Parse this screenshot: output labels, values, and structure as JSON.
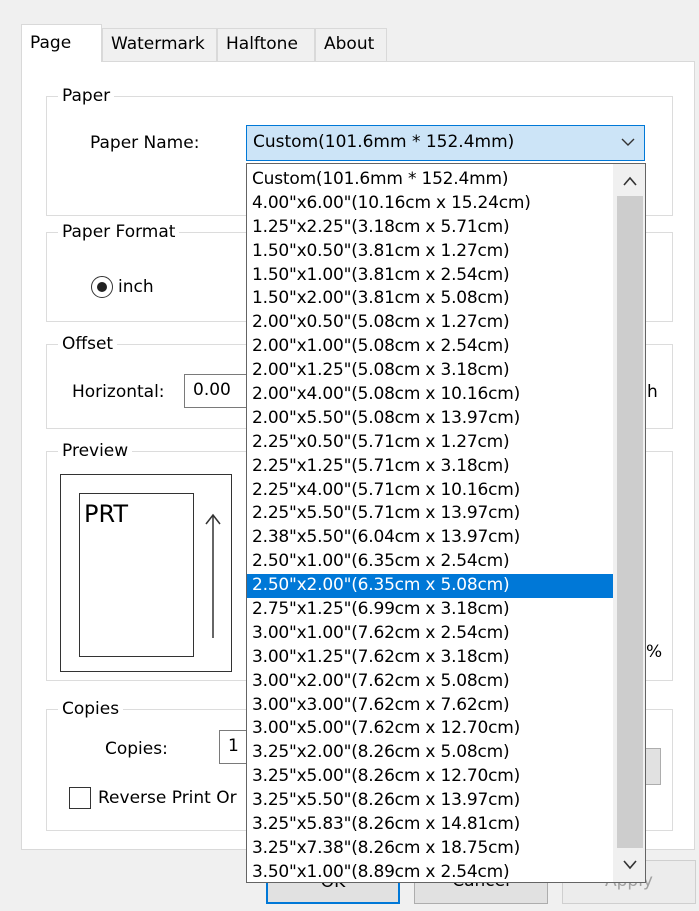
{
  "tabs": [
    {
      "label": "Page",
      "active": true
    },
    {
      "label": "Watermark",
      "active": false
    },
    {
      "label": "Halftone",
      "active": false
    },
    {
      "label": "About",
      "active": false
    }
  ],
  "paper": {
    "group_title": "Paper",
    "name_label": "Paper Name:",
    "selected_value": "Custom(101.6mm * 152.4mm)"
  },
  "paper_format": {
    "group_title": "Paper Format",
    "radio_label": "inch",
    "radio_checked": true
  },
  "offset": {
    "group_title": "Offset",
    "horizontal_label": "Horizontal:",
    "horizontal_value": "0.00",
    "unit_partial": "h"
  },
  "preview": {
    "group_title": "Preview",
    "preview_text": "PRT",
    "percent_partial": "%"
  },
  "copies": {
    "group_title": "Copies",
    "copies_label": "Copies:",
    "copies_value": "1",
    "reverse_label": "Reverse Print Or",
    "reverse_checked": false
  },
  "dropdown": {
    "items": [
      "Custom(101.6mm * 152.4mm)",
      "4.00\"x6.00\"(10.16cm x 15.24cm)",
      "1.25\"x2.25\"(3.18cm x 5.71cm)",
      "1.50\"x0.50\"(3.81cm x 1.27cm)",
      "1.50\"x1.00\"(3.81cm x 2.54cm)",
      "1.50\"x2.00\"(3.81cm x 5.08cm)",
      "2.00\"x0.50\"(5.08cm x 1.27cm)",
      "2.00\"x1.00\"(5.08cm x 2.54cm)",
      "2.00\"x1.25\"(5.08cm x 3.18cm)",
      "2.00\"x4.00\"(5.08cm x 10.16cm)",
      "2.00\"x5.50\"(5.08cm x 13.97cm)",
      "2.25\"x0.50\"(5.71cm x 1.27cm)",
      "2.25\"x1.25\"(5.71cm x 3.18cm)",
      "2.25\"x4.00\"(5.71cm x 10.16cm)",
      "2.25\"x5.50\"(5.71cm x 13.97cm)",
      "2.38\"x5.50\"(6.04cm x 13.97cm)",
      "2.50\"x1.00\"(6.35cm x 2.54cm)",
      "2.50\"x2.00\"(6.35cm x 5.08cm)",
      "2.75\"x1.25\"(6.99cm x 3.18cm)",
      "3.00\"x1.00\"(7.62cm x 2.54cm)",
      "3.00\"x1.25\"(7.62cm x 3.18cm)",
      "3.00\"x2.00\"(7.62cm x 5.08cm)",
      "3.00\"x3.00\"(7.62cm x 7.62cm)",
      "3.00\"x5.00\"(7.62cm x 12.70cm)",
      "3.25\"x2.00\"(8.26cm x 5.08cm)",
      "3.25\"x5.00\"(8.26cm x 12.70cm)",
      "3.25\"x5.50\"(8.26cm x 13.97cm)",
      "3.25\"x5.83\"(8.26cm x 14.81cm)",
      "3.25\"x7.38\"(8.26cm x 18.75cm)",
      "3.50\"x1.00\"(8.89cm x 2.54cm)"
    ],
    "highlighted_index": 17
  },
  "buttons": {
    "ok": "OK",
    "cancel": "Cancel",
    "apply": "Apply"
  },
  "icons": {
    "combo_arrow": "chevron-down-icon",
    "scroll_up": "chevron-up-icon",
    "scroll_down": "chevron-down-icon",
    "preview_arrow": "arrow-up-icon"
  },
  "colors": {
    "accent": "#0078d7",
    "combo_bg": "#cce4f7",
    "window_bg": "#f0f0f0"
  }
}
